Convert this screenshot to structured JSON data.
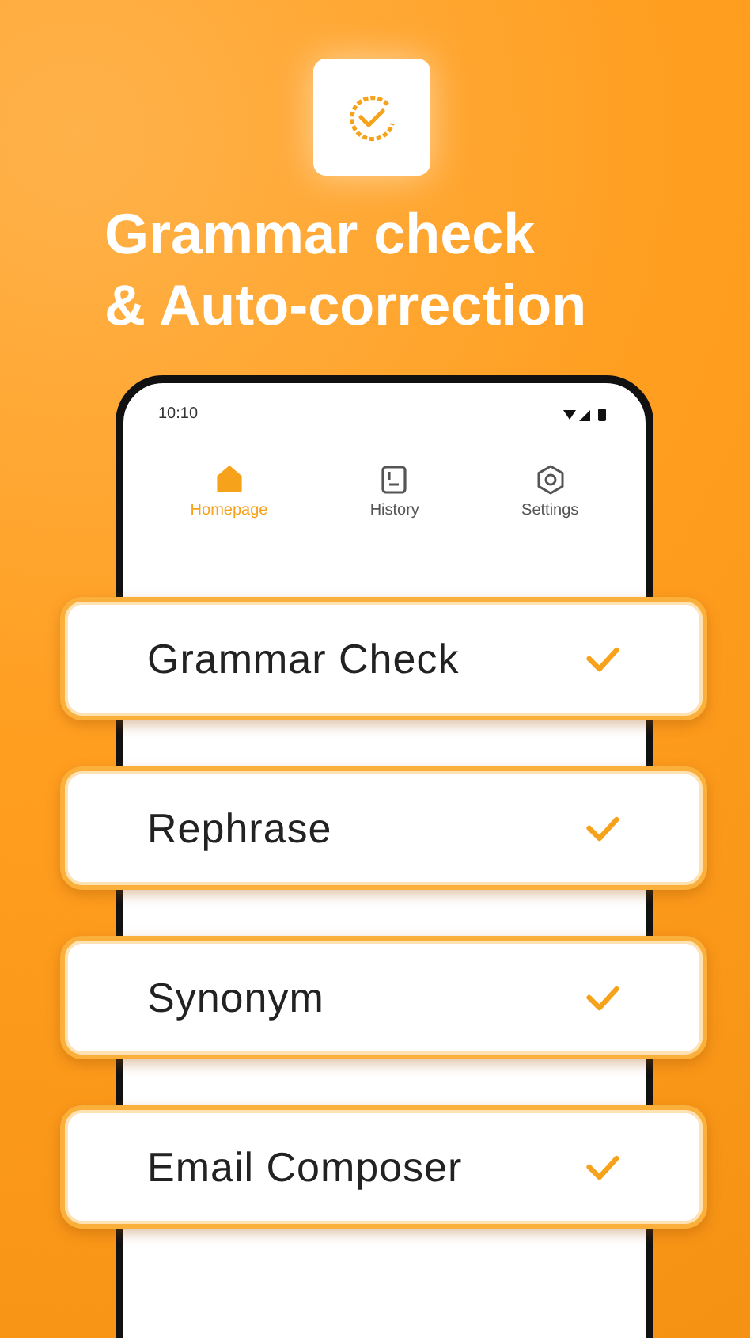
{
  "headline": [
    "Grammar check",
    "& Auto-correction"
  ],
  "phone": {
    "status_time": "10:10",
    "tabs": [
      {
        "label": "Homepage",
        "selected": true
      },
      {
        "label": "History",
        "selected": false
      },
      {
        "label": "Settings",
        "selected": false
      }
    ]
  },
  "features": [
    {
      "title": "Grammar Check"
    },
    {
      "title": "Rephrase"
    },
    {
      "title": "Synonym"
    },
    {
      "title": "Email Composer"
    }
  ]
}
